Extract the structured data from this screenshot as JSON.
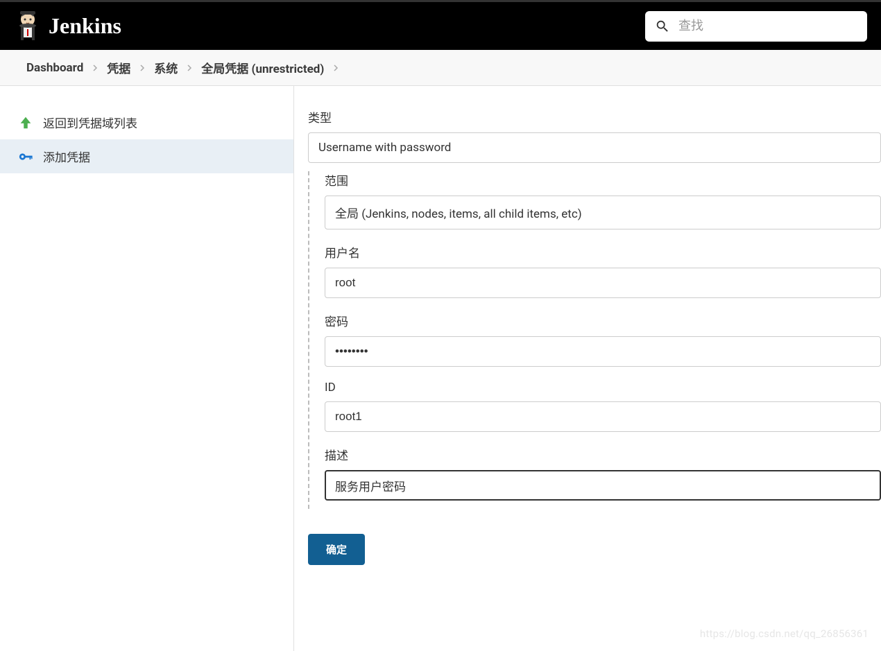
{
  "header": {
    "brand": "Jenkins",
    "search_placeholder": "查找"
  },
  "breadcrumb": {
    "items": [
      "Dashboard",
      "凭据",
      "系统",
      "全局凭据 (unrestricted)"
    ]
  },
  "sidebar": {
    "items": [
      {
        "label": "返回到凭据域列表"
      },
      {
        "label": "添加凭据"
      }
    ]
  },
  "form": {
    "type_label": "类型",
    "type_value": "Username with password",
    "fields": {
      "scope_label": "范围",
      "scope_value": "全局 (Jenkins, nodes, items, all child items, etc)",
      "username_label": "用户名",
      "username_value": "root",
      "password_label": "密码",
      "password_value": "••••••••",
      "id_label": "ID",
      "id_value": "root1",
      "desc_label": "描述",
      "desc_value": "服务用户密码"
    },
    "submit_label": "确定"
  },
  "watermark": "https://blog.csdn.net/qq_26856361"
}
